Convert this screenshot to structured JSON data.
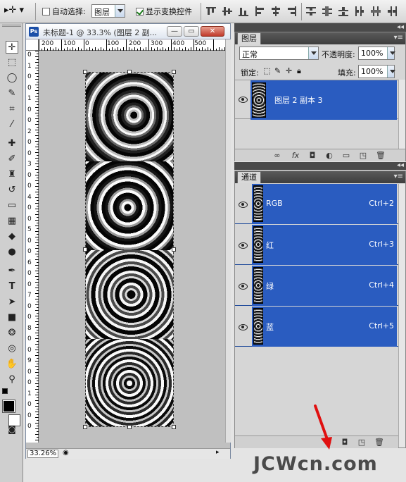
{
  "options_bar": {
    "auto_select_label": "自动选择:",
    "auto_select_checked": false,
    "target_select": "图层",
    "show_transform_label": "显示变换控件",
    "show_transform_checked": true
  },
  "document": {
    "title": "未标题-1 @ 33.3% (图层 2 副...",
    "zoom": "33.26%",
    "ruler_top_ticks": [
      "200",
      "100",
      "0",
      "100",
      "200",
      "300",
      "400",
      "500"
    ],
    "ruler_left_ticks": [
      "0",
      "1",
      "0",
      "0",
      "1",
      "0",
      "0",
      "2",
      "0",
      "0",
      "3",
      "0",
      "0",
      "4",
      "0",
      "0",
      "5",
      "0",
      "0",
      "6",
      "0",
      "0",
      "7",
      "0",
      "0",
      "8",
      "0",
      "0",
      "9",
      "0",
      "0",
      "1",
      "0",
      "0",
      "0"
    ]
  },
  "layers_panel": {
    "tab": "图层",
    "blend_mode": "正常",
    "opacity_label": "不透明度:",
    "opacity_value": "100%",
    "lock_label": "锁定:",
    "fill_label": "填充:",
    "fill_value": "100%",
    "layer_name": "图层 2 副本 3"
  },
  "channels_panel": {
    "tab": "通道",
    "channels": [
      {
        "name": "RGB",
        "shortcut": "Ctrl+2"
      },
      {
        "name": "红",
        "shortcut": "Ctrl+3"
      },
      {
        "name": "绿",
        "shortcut": "Ctrl+4"
      },
      {
        "name": "蓝",
        "shortcut": "Ctrl+5"
      }
    ]
  },
  "watermark": "JCWcn.com",
  "colors": {
    "selection_blue": "#2a5cc0",
    "arrow_red": "#e01010"
  }
}
